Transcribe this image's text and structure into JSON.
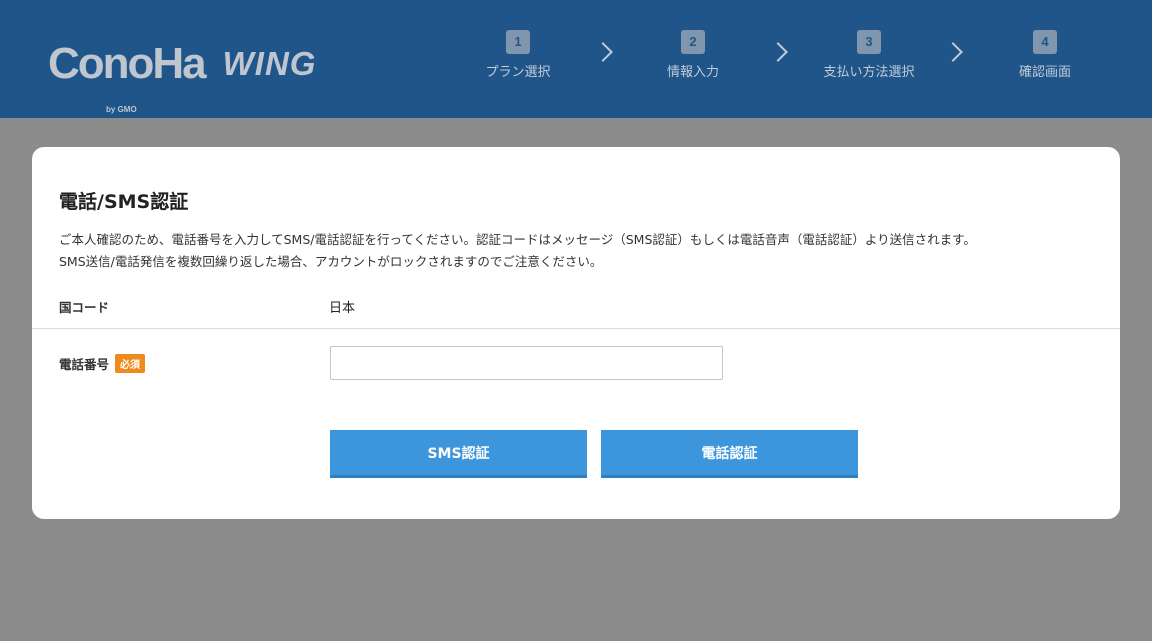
{
  "header": {
    "logo_text": "ConoHa",
    "logo_by": "by GMO",
    "logo_wing": "WING",
    "steps": [
      {
        "num": "1",
        "label": "プラン選択"
      },
      {
        "num": "2",
        "label": "情報入力"
      },
      {
        "num": "3",
        "label": "支払い方法選択"
      },
      {
        "num": "4",
        "label": "確認画面"
      }
    ]
  },
  "card": {
    "title": "電話/SMS認証",
    "desc_line1": "ご本人確認のため、電話番号を入力してSMS/電話認証を行ってください。認証コードはメッセージ（SMS認証）もしくは電話音声（電話認証）より送信されます。",
    "desc_line2": "SMS送信/電話発信を複数回繰り返した場合、アカウントがロックされますのでご注意ください。",
    "country_label": "国コード",
    "country_value": "日本",
    "phone_label": "電話番号",
    "required_badge": "必須",
    "phone_value": "",
    "sms_button": "SMS認証",
    "call_button": "電話認証"
  },
  "colors": {
    "header_bg": "#1f5589",
    "page_bg": "#8c8c8c",
    "button_bg": "#3d95dc",
    "badge_bg": "#f08a1c"
  }
}
